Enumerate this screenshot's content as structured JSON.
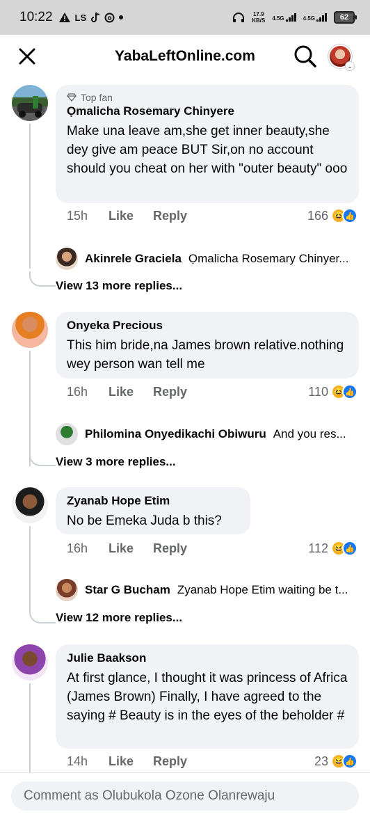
{
  "status_bar": {
    "time": "10:22",
    "carrier_text": "LS",
    "speed_value": "17.9",
    "speed_unit": "KB/S",
    "net1": "4.5G",
    "net2": "4.5G",
    "battery": "62"
  },
  "header": {
    "title": "YabaLeftOnline.com"
  },
  "comments": [
    {
      "badge": "Top fan",
      "author": "Ọmalicha Rosemary Chinyere",
      "text": "Make una leave am,she get inner beauty,she dey give am peace BUT Sir,on no account should you cheat on her with \"outer beauty\" ooo",
      "time": "15h",
      "like": "Like",
      "reply": "Reply",
      "reaction_count": "166",
      "reply_preview": {
        "name": "Akinrele Graciela",
        "snippet": "Ọmalicha Rosemary Chinyer..."
      },
      "view_more": "View 13 more replies..."
    },
    {
      "author": "Onyeka Precious",
      "text": "This him bride,na James brown relative.nothing wey person wan tell me",
      "time": "16h",
      "like": "Like",
      "reply": "Reply",
      "reaction_count": "110",
      "reply_preview": {
        "name": "Philomina Onyedikachi Obiwuru",
        "snippet": "And you res..."
      },
      "view_more": "View 3 more replies..."
    },
    {
      "author": "Zyanab Hope Etim",
      "text": "No be Emeka Juda b this?",
      "time": "16h",
      "like": "Like",
      "reply": "Reply",
      "reaction_count": "112",
      "reply_preview": {
        "name": "Star G Bucham",
        "snippet": "Zyanab Hope Etim waiting be t..."
      },
      "view_more": "View 12 more replies..."
    },
    {
      "author": "Julie Baakson",
      "text": "At first glance, I thought it was princess of Africa (James Brown) Finally, I have agreed to the saying # Beauty is in the eyes of the beholder #",
      "time": "14h",
      "like": "Like",
      "reply": "Reply",
      "reaction_count": "23"
    }
  ],
  "composer": {
    "placeholder": "Comment as Olubukola Ozone Olanrewaju"
  },
  "colors": {
    "bubble_bg": "#f0f2f5",
    "meta_text": "#65676b",
    "like_blue": "#1877f2",
    "haha_yellow": "#f7b125"
  }
}
